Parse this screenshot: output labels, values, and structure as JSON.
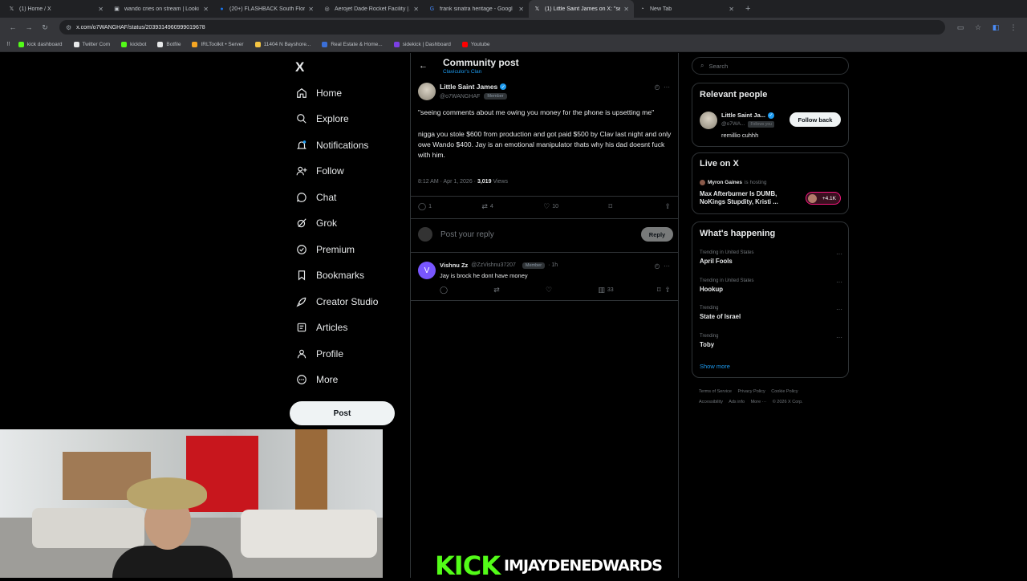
{
  "browser": {
    "tabs": [
      {
        "title": "(1) Home / X",
        "icon": "x-icon",
        "active": false
      },
      {
        "title": "wando cries on stream | Looki",
        "icon": "video-icon",
        "active": false
      },
      {
        "title": "(20+) FLASHBACK South Flori",
        "icon": "facebook-icon",
        "active": false
      },
      {
        "title": "Aerojet Dade Rocket Facility | A",
        "icon": "web-icon",
        "active": false
      },
      {
        "title": "frank sinatra heritage - Googl",
        "icon": "google-icon",
        "active": false
      },
      {
        "title": "(1) Little Saint James on X: \"se",
        "icon": "x-icon",
        "active": true
      },
      {
        "title": "New Tab",
        "icon": "newtab-icon",
        "active": false
      }
    ],
    "url": "x.com/o7WANGHAF/status/2039314960999019678",
    "bookmarks": [
      {
        "label": "kick dashboard",
        "color": "#53fc18"
      },
      {
        "label": "Twitter Com",
        "color": "#e7e9ea"
      },
      {
        "label": "kickbot",
        "color": "#53fc18"
      },
      {
        "label": "Botfile",
        "color": "#e7e9ea"
      },
      {
        "label": "IRLToolkit • Server",
        "color": "#f5a623"
      },
      {
        "label": "11404 N Bayshore...",
        "color": "#f5c542"
      },
      {
        "label": "Real Estate & Home...",
        "color": "#3b6fd8"
      },
      {
        "label": "sidekick | Dashboard",
        "color": "#7b3fe4"
      },
      {
        "label": "Youtube",
        "color": "#ff0000"
      }
    ]
  },
  "nav": {
    "logo": "X",
    "items": [
      "Home",
      "Explore",
      "Notifications",
      "Follow",
      "Chat",
      "Grok",
      "Premium",
      "Bookmarks",
      "Creator Studio",
      "Articles",
      "Profile",
      "More"
    ],
    "post_label": "Post"
  },
  "header": {
    "title": "Community post",
    "subtitle": "Claviculor's Clan"
  },
  "post": {
    "author": "Little Saint James",
    "handle": "@o7WANGHAF",
    "member_badge": "Member",
    "paragraph1": "\"seeing comments about me owing you money for the phone is upsetting me\"",
    "paragraph2": "nigga you stole $600 from production and got paid $500 by Clav last night and only owe Wando $400. Jay is an emotional manipulator thats why his dad doesnt fuck with him.",
    "time": "8:12 AM · Apr 1, 2026 ·",
    "views_count": "3,019",
    "views_label": "Views",
    "replies": "1",
    "reposts": "4",
    "likes": "10"
  },
  "reply_box": {
    "placeholder": "Post your reply",
    "button": "Reply"
  },
  "comment": {
    "avatar_letter": "V",
    "author": "Vishnu Zz",
    "handle": "@ZzVishnu37207",
    "badge": "Member",
    "time": "· 1h",
    "text": "Jay is brock he dont have money",
    "views": "33"
  },
  "sidebar": {
    "search_placeholder": "Search",
    "relevant_title": "Relevant people",
    "relevant_name": "Little Saint Ja...",
    "relevant_handle": "@o7WA...",
    "follows_you": "Follows you",
    "follow_back": "Follow back",
    "relevant_bio": "remillio cuhhh",
    "live_title": "Live on X",
    "live_host": "Myron Gaines",
    "live_host_suffix": "is hosting",
    "live_stream": "Max Afterburner Is DUMB, NoKings Stupdity,  Kristi ...",
    "live_count": "+4.1K",
    "happening_title": "What's happening",
    "trends": [
      {
        "context": "Trending in United States",
        "topic": "April Fools"
      },
      {
        "context": "Trending in United States",
        "topic": "Hookup"
      },
      {
        "context": "Trending",
        "topic": "State of Israel"
      },
      {
        "context": "Trending",
        "topic": "Toby"
      }
    ],
    "show_more": "Show more",
    "footer": [
      "Terms of Service",
      "Privacy Policy",
      "Cookie Policy",
      "Accessibility",
      "Ads info",
      "More ···",
      "© 2026 X Corp."
    ]
  },
  "overlay": {
    "kick_logo": "KICK",
    "channel": "IMJAYDENEDWARDS"
  }
}
